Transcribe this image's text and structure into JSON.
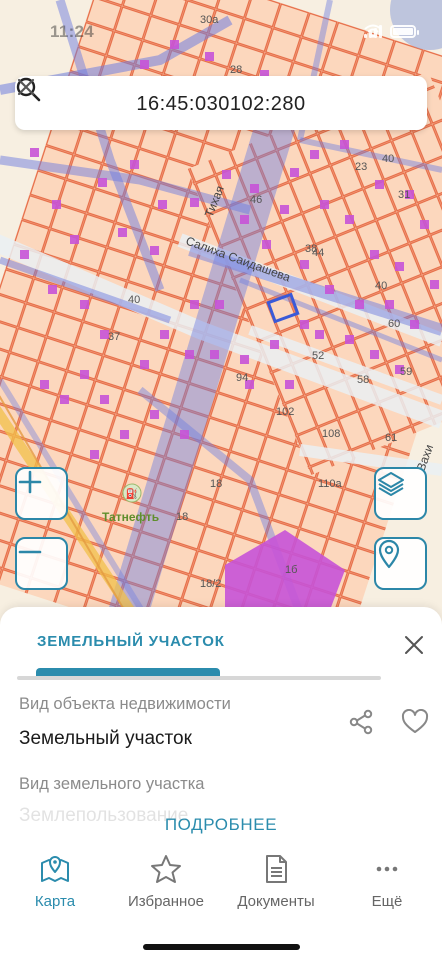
{
  "status_bar": {
    "time": "11:24"
  },
  "search": {
    "query": "16:45:030102:280"
  },
  "map": {
    "street_labels": [
      "Тихая",
      "Салиха Саидашева"
    ],
    "poi_label": "Татнефть",
    "parcel_numbers": [
      "30а",
      "28",
      "23",
      "40",
      "46",
      "31",
      "44",
      "38",
      "40",
      "60",
      "37",
      "40",
      "52",
      "94",
      "58",
      "59",
      "102",
      "108",
      "61",
      "110а",
      "18",
      "18",
      "18/2",
      "1б"
    ],
    "street_fragment": "Вахи"
  },
  "sheet": {
    "tab_label": "ЗЕМЕЛЬНЫЙ УЧАСТОК",
    "field1_label": "Вид объекта недвижимости",
    "field1_value": "Земельный участок",
    "field2_label": "Вид земельного участка",
    "field2_value": "Землепользование",
    "more_label": "ПОДРОБНЕЕ"
  },
  "nav": {
    "items": [
      {
        "label": "Карта",
        "icon": "map-icon",
        "active": true
      },
      {
        "label": "Избранное",
        "icon": "star-icon",
        "active": false
      },
      {
        "label": "Документы",
        "icon": "document-icon",
        "active": false
      },
      {
        "label": "Ещё",
        "icon": "more-icon",
        "active": false
      }
    ]
  },
  "colors": {
    "accent": "#2b8cad",
    "parcel_border": "#e5653f",
    "parcel_fill": "#fbd9c0",
    "road_overlay": "#6f7ee0",
    "building": "#c653d7"
  }
}
